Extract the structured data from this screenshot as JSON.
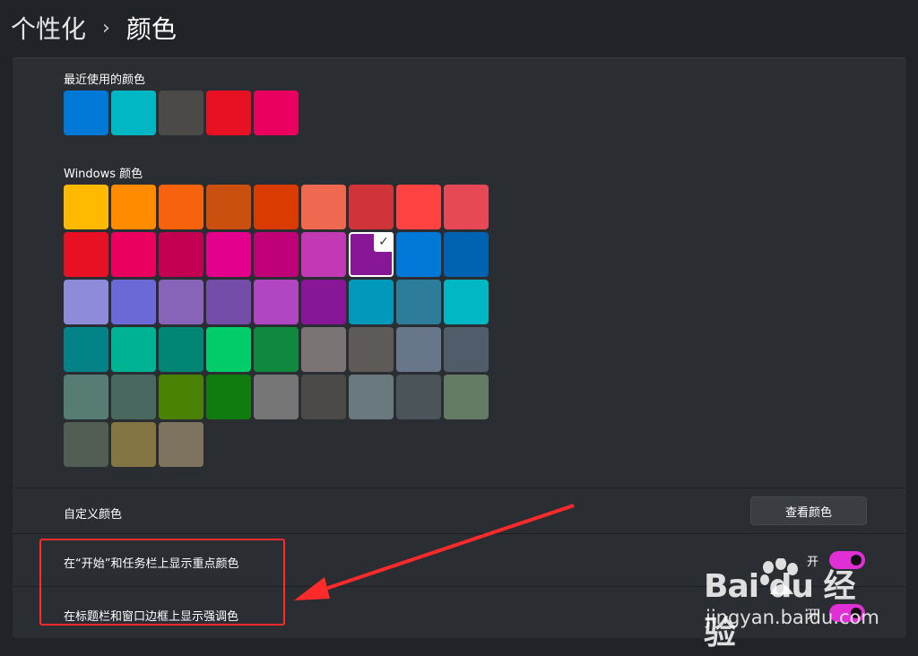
{
  "breadcrumb": {
    "parent": "个性化",
    "separator": "›",
    "current": "颜色"
  },
  "recent_colors": {
    "label": "最近使用的颜色",
    "swatches": [
      "#0078d7",
      "#00b7c3",
      "#4c4a48",
      "#e81123",
      "#ea005e"
    ]
  },
  "windows_colors": {
    "label": "Windows 颜色",
    "selected": "#881798",
    "rows": [
      [
        "#ffb900",
        "#ff8c00",
        "#f7630c",
        "#ca5010",
        "#da3b01",
        "#ef6950",
        "#d13438",
        "#ff4343",
        "#e74856"
      ],
      [
        "#e81123",
        "#ea005e",
        "#c30052",
        "#e3008c",
        "#bf0077",
        "#c239b3",
        "#881798",
        "#0078d7",
        "#0063b1"
      ],
      [
        "#8e8cd8",
        "#6b69d6",
        "#8764b8",
        "#744da9",
        "#b146c2",
        "#881798",
        "#0099bc",
        "#2d7d9a",
        "#00b7c3"
      ],
      [
        "#038387",
        "#00b294",
        "#018574",
        "#00cc6a",
        "#10893e",
        "#7a7574",
        "#5d5a58",
        "#68768a",
        "#515c6b"
      ],
      [
        "#567c73",
        "#486860",
        "#498205",
        "#107c10",
        "#767676",
        "#4c4a48",
        "#69797e",
        "#4a5459",
        "#647c64"
      ],
      [
        "#525e54",
        "#847545",
        "#7e735f"
      ]
    ]
  },
  "custom_colors": {
    "label": "自定义颜色",
    "button_label": "查看颜色"
  },
  "toggles": [
    {
      "label": "在“开始”和任务栏上显示重点颜色",
      "state": "开",
      "on": true
    },
    {
      "label": "在标题栏和窗口边框上显示强调色",
      "state": "开",
      "on": true
    }
  ],
  "watermark": {
    "logo": "Bai du 经验",
    "url": "jingyan.baidu.com"
  },
  "colors": {
    "accent": "#e12fd6",
    "annotation": "#ff2a2a"
  }
}
